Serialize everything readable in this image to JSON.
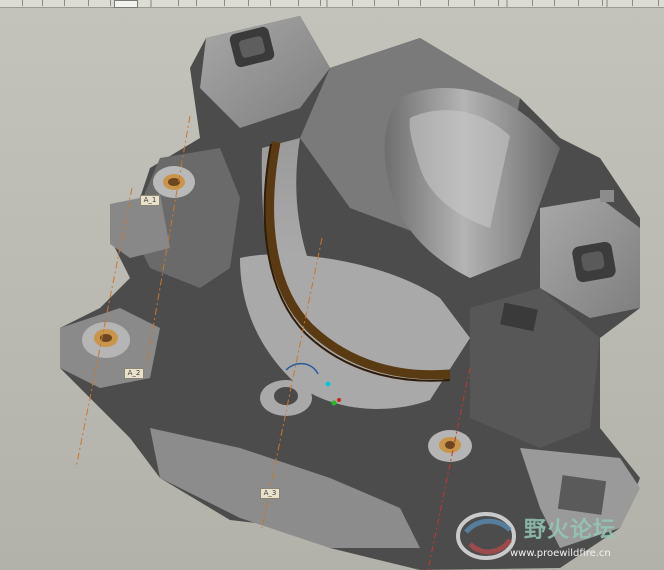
{
  "datum_tags": [
    "A_1",
    "A_2",
    "A_3"
  ],
  "watermark": {
    "title": "野火论坛",
    "url": "www.proewildfire.cn"
  },
  "colors": {
    "background": "#bbbbb3",
    "part_body": "#8e8e8e",
    "part_shadow": "#4a4a4a",
    "groove": "#5a3a12",
    "boss_ring": "#c8954a",
    "datum_axis": "#c7782e"
  }
}
